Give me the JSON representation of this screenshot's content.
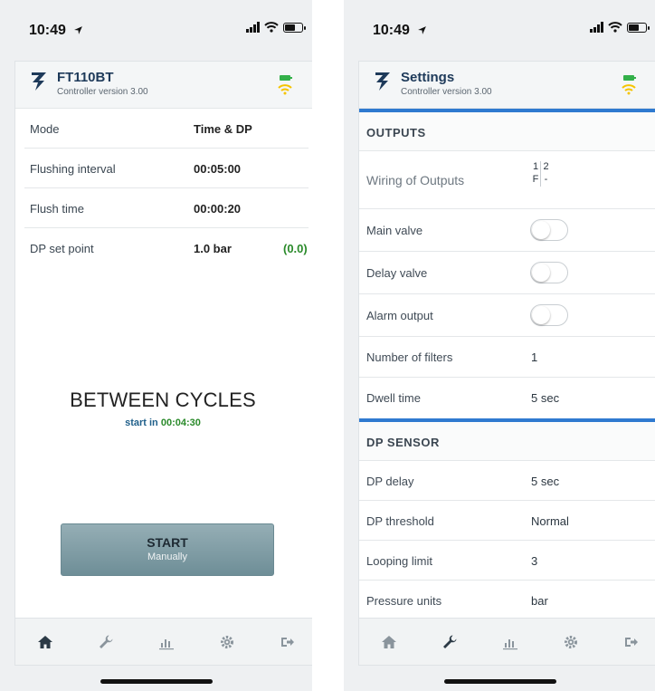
{
  "left": {
    "status": {
      "time": "10:49"
    },
    "header": {
      "title": "FT110BT",
      "subtitle": "Controller version 3.00"
    },
    "rows": [
      {
        "label": "Mode",
        "value": "Time & DP"
      },
      {
        "label": "Flushing interval",
        "value": "00:05:00"
      },
      {
        "label": "Flush time",
        "value": "00:00:20"
      },
      {
        "label": "DP set point",
        "value": "1.0 bar",
        "extra": "(0.0)"
      }
    ],
    "state": {
      "title": "BETWEEN CYCLES",
      "prefix": "start in",
      "countdown": "00:04:30"
    },
    "start_button": {
      "label": "START",
      "sublabel": "Manually"
    },
    "tabs": [
      "home-icon",
      "wrench-icon",
      "chart-icon",
      "gear-icon",
      "exit-icon"
    ],
    "active_tab": "home-icon"
  },
  "right": {
    "status": {
      "time": "10:49"
    },
    "header": {
      "title": "Settings",
      "subtitle": "Controller version 3.00"
    },
    "outputs": {
      "title": "OUTPUTS",
      "wiring_label": "Wiring of Outputs",
      "wiring": [
        "1",
        "2",
        "F",
        "-"
      ],
      "main_valve": {
        "label": "Main valve",
        "on": false
      },
      "delay_valve": {
        "label": "Delay valve",
        "on": false
      },
      "alarm_output": {
        "label": "Alarm output",
        "on": false
      },
      "number_of_filters": {
        "label": "Number of filters",
        "value": "1"
      },
      "dwell_time": {
        "label": "Dwell time",
        "value": "5 sec"
      }
    },
    "dp_sensor": {
      "title": "DP SENSOR",
      "dp_delay": {
        "label": "DP delay",
        "value": "5 sec"
      },
      "dp_threshold": {
        "label": "DP threshold",
        "value": "Normal"
      },
      "looping_limit": {
        "label": "Looping limit",
        "value": "3"
      },
      "pressure_units": {
        "label": "Pressure units",
        "value": "bar"
      }
    },
    "tabs": [
      "home-icon",
      "wrench-icon",
      "chart-icon",
      "gear-icon",
      "exit-icon"
    ],
    "active_tab": "wrench-icon"
  },
  "colors": {
    "accent": "#2f7ad0",
    "battery": "#33b04a",
    "wifi": "#f5c400",
    "brand": "#1e3a5a",
    "positive": "#2a8a2a"
  }
}
